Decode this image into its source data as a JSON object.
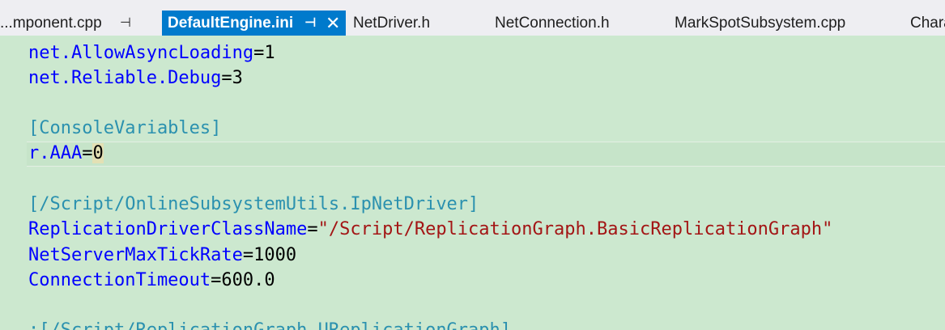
{
  "tabs": [
    {
      "label": "...mponent.cpp"
    },
    {
      "label": "DefaultEngine.ini",
      "active": true
    },
    {
      "label": "NetDriver.h"
    },
    {
      "label": "NetConnection.h"
    },
    {
      "label": "MarkSpotSubsystem.cpp"
    },
    {
      "label": "Chara"
    }
  ],
  "icons": {
    "pin": "⊣",
    "pin_active": "⊣",
    "close": "✕"
  },
  "editor": {
    "lines": [
      {
        "key": "net.AllowAsyncLoading",
        "op": "=",
        "val": "1"
      },
      {
        "key": "net.Reliable.Debug",
        "op": "=",
        "val": "3"
      },
      {
        "section": "[ConsoleVariables]"
      },
      {
        "key": "r.AAA",
        "op": "=",
        "val": "0"
      },
      {
        "section": "[/Script/OnlineSubsystemUtils.IpNetDriver]"
      },
      {
        "key": "ReplicationDriverClassName",
        "op": "=",
        "str": "\"/Script/ReplicationGraph.BasicReplicationGraph\""
      },
      {
        "key": "NetServerMaxTickRate",
        "op": "=",
        "val": "1000"
      },
      {
        "key": "ConnectionTimeout",
        "op": "=",
        "val": "600.0"
      },
      {
        "section": ";[/Script/ReplicationGraph.UReplicationGraph]"
      }
    ]
  },
  "colors": {
    "editor_bg": "#cce8cf",
    "tab_active_bg": "#007acc",
    "key": "#0000ff",
    "string": "#a31515",
    "section": "#2b91af"
  }
}
